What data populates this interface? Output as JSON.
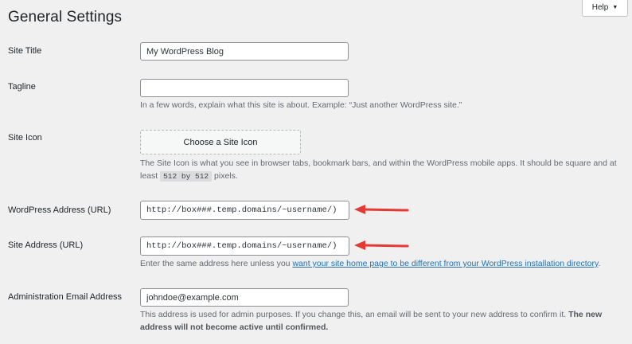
{
  "page": {
    "title": "General Settings",
    "help_label": "Help"
  },
  "fields": {
    "site_title": {
      "label": "Site Title",
      "value": "My WordPress Blog"
    },
    "tagline": {
      "label": "Tagline",
      "value": "",
      "description": "In a few words, explain what this site is about. Example: “Just another WordPress site.”"
    },
    "site_icon": {
      "label": "Site Icon",
      "button_label": "Choose a Site Icon",
      "description_line1": "The Site Icon is what you see in browser tabs, bookmark bars, and within the WordPress mobile apps. It should be square and at",
      "description_prefix": "least",
      "size_code": "512 by 512",
      "description_suffix": "pixels."
    },
    "wordpress_address": {
      "label": "WordPress Address (URL)",
      "value": "http://box###.temp.domains/~username/)"
    },
    "site_address": {
      "label": "Site Address (URL)",
      "value": "http://box###.temp.domains/~username/)",
      "description_prefix": "Enter the same address here unless you",
      "link_text": "want your site home page to be different from your WordPress installation directory",
      "description_suffix": "."
    },
    "admin_email": {
      "label": "Administration Email Address",
      "value": "johndoe@example.com",
      "description_line1": "This address is used for admin purposes. If you change this, an email will be sent to your new address to confirm it.",
      "strong_part1": "The new",
      "strong_part2": "address will not become active until confirmed."
    }
  },
  "colors": {
    "annotation_arrow": "#e53935",
    "link": "#2271b1"
  }
}
